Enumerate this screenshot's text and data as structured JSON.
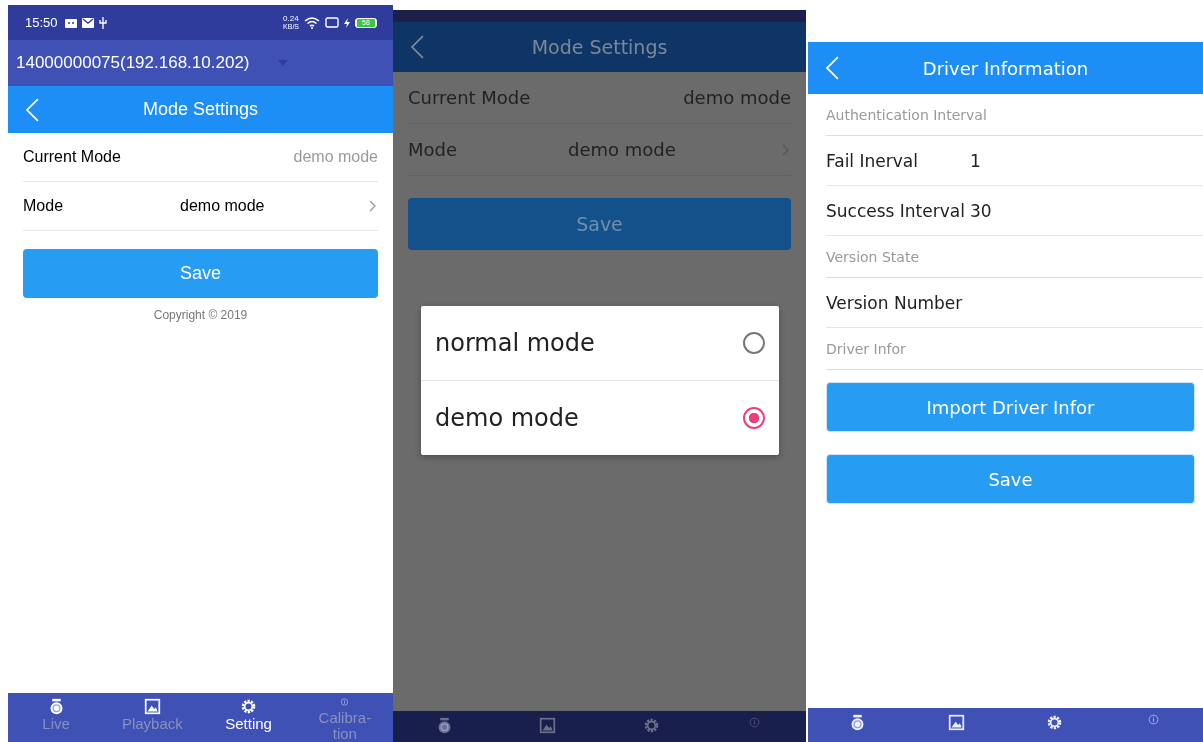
{
  "screens": [
    {
      "dimmed": false,
      "status_bar": {
        "time": "15:50",
        "net_speed": "0.24",
        "net_unit": "KB/S",
        "battery": "58"
      },
      "device_selector": {
        "value": "14000000075(192.168.10.202)"
      },
      "header": {
        "title": "Mode Settings"
      },
      "body": [
        {
          "kind": "info",
          "label": "Current Mode",
          "value": "demo mode"
        },
        {
          "kind": "select",
          "label": "Mode",
          "value": "demo mode"
        },
        {
          "kind": "button",
          "label": "Save"
        },
        {
          "kind": "footnote",
          "label": "Copyright © 2019"
        }
      ],
      "nav": [
        {
          "label": "Live",
          "selected": false
        },
        {
          "label": "Playback",
          "selected": false
        },
        {
          "label": "Setting",
          "selected": true
        },
        {
          "label": "Calibra-\ntion",
          "selected": false
        }
      ]
    },
    {
      "dimmed": true,
      "header": {
        "title": "Mode Settings"
      },
      "body": [
        {
          "kind": "info",
          "label": "Current Mode",
          "value": "demo mode"
        },
        {
          "kind": "select",
          "label": "Mode",
          "value": "demo mode"
        },
        {
          "kind": "button",
          "label": "Save"
        }
      ],
      "dialog": {
        "options": [
          {
            "label": "normal mode",
            "selected": false
          },
          {
            "label": "demo mode",
            "selected": true
          }
        ]
      }
    },
    {
      "dimmed": false,
      "header": {
        "title": "Driver Information"
      },
      "body": [
        {
          "kind": "section",
          "label": "Authentication Interval"
        },
        {
          "kind": "field",
          "label": "Fail Inerval",
          "value": "1"
        },
        {
          "kind": "field",
          "label": "Success Interval",
          "value": "30"
        },
        {
          "kind": "section",
          "label": "Version State"
        },
        {
          "kind": "field",
          "label": "Version Number"
        },
        {
          "kind": "section",
          "label": "Driver Infor"
        },
        {
          "kind": "button",
          "label": "Import Driver Infor"
        },
        {
          "kind": "button",
          "label": "Save"
        }
      ]
    }
  ]
}
